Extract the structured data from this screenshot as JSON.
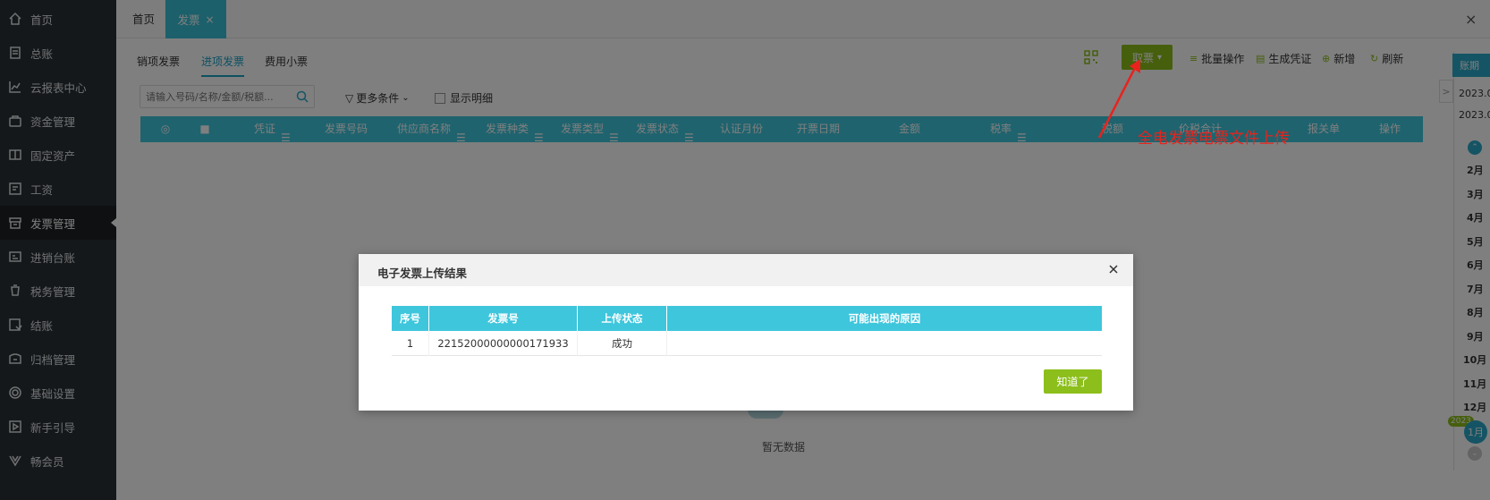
{
  "sidebar": {
    "items": [
      {
        "label": "首页",
        "icon": "home-icon"
      },
      {
        "label": "总账",
        "icon": "ledger-icon"
      },
      {
        "label": "云报表中心",
        "icon": "chart-icon"
      },
      {
        "label": "资金管理",
        "icon": "wallet-icon"
      },
      {
        "label": "固定资产",
        "icon": "asset-icon"
      },
      {
        "label": "工资",
        "icon": "salary-icon"
      },
      {
        "label": "发票管理",
        "icon": "invoice-icon",
        "active": true
      },
      {
        "label": "进销台账",
        "icon": "account-book-icon"
      },
      {
        "label": "税务管理",
        "icon": "tax-icon"
      },
      {
        "label": "结账",
        "icon": "checkout-icon"
      },
      {
        "label": "归档管理",
        "icon": "archive-icon"
      },
      {
        "label": "基础设置",
        "icon": "gear-icon"
      },
      {
        "label": "新手引导",
        "icon": "guide-icon"
      },
      {
        "label": "畅会员",
        "icon": "vip-icon"
      }
    ]
  },
  "tabs": {
    "home": "首页",
    "invoice": "发票",
    "invoice_close": "×",
    "window_close": "×"
  },
  "subtabs": [
    "销项发票",
    "进项发票",
    "费用小票"
  ],
  "toolbar": {
    "fetch": "取票",
    "batch": "批量操作",
    "voucher": "生成凭证",
    "add": "新增",
    "refresh": "刷新"
  },
  "filters": {
    "search_placeholder": "请输入号码/名称/金额/税额...",
    "more": "更多条件",
    "show_detail": "显示明细"
  },
  "table": {
    "headers": [
      "凭证",
      "发票号码",
      "供应商名称",
      "发票种类",
      "发票类型",
      "发票状态",
      "认证月份",
      "开票日期",
      "金额",
      "税率",
      "税额",
      "价税合计",
      "报关单",
      "操作"
    ],
    "empty_text": "暂无数据"
  },
  "right_panel": {
    "period_label": "账期",
    "toggle": ">",
    "dates": [
      "2023.0",
      "2023.0"
    ],
    "months": [
      "2月",
      "3月",
      "4月",
      "5月",
      "6月",
      "7月",
      "8月",
      "9月",
      "10月",
      "11月",
      "12月"
    ],
    "year_badge": "2023",
    "current_month": "1月"
  },
  "annotation": {
    "text": "全电发票电票文件上传",
    "color": "#e8231d"
  },
  "modal": {
    "title": "电子发票上传结果",
    "close": "×",
    "columns": [
      "序号",
      "发票号",
      "上传状态",
      "可能出现的原因"
    ],
    "rows": [
      {
        "index": "1",
        "invoice_no": "22152000000000171933",
        "status": "成功",
        "reason": ""
      }
    ],
    "ok_button": "知道了"
  },
  "colors": {
    "accent": "#3ec6dc",
    "green": "#8cbf1b",
    "sidebar": "#2b3035",
    "red": "#e8231d"
  }
}
